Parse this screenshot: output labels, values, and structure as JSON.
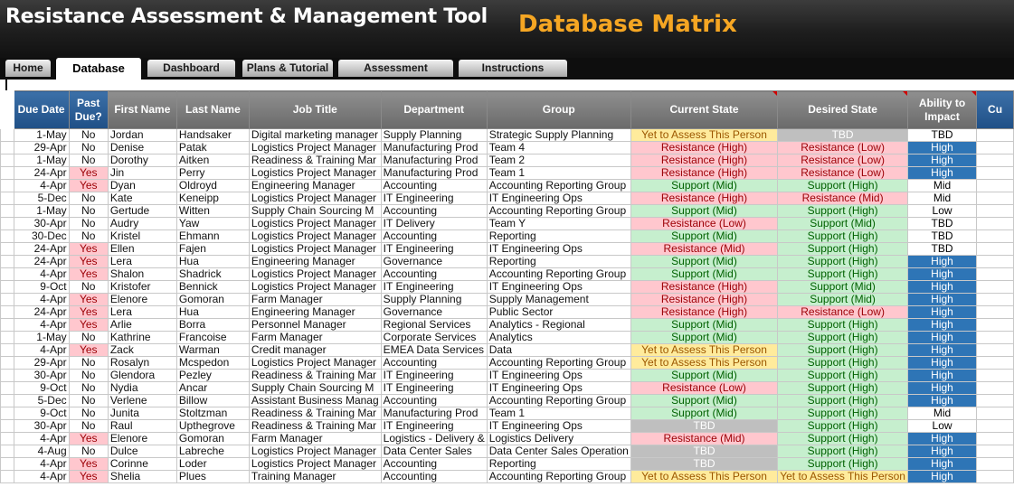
{
  "app": {
    "title": "Resistance Assessment & Management Tool",
    "subtitle": "Database Matrix"
  },
  "tabs": [
    {
      "label": "Home"
    },
    {
      "label": "Database"
    },
    {
      "label": "Dashboard"
    },
    {
      "label": "Plans & Tutorial"
    },
    {
      "label": "Assessment"
    },
    {
      "label": "Instructions"
    }
  ],
  "columns": [
    "Due Date",
    "Past Due?",
    "First Name",
    "Last Name",
    "Job Title",
    "Department",
    "Group",
    "Current State",
    "Desired State",
    "Ability to Impact",
    "Cu"
  ],
  "colors": {
    "header_blue": "#2b5f97",
    "header_gray": "#7a7a7a",
    "yes_bg": "#ffc7ce",
    "resistance_bg": "#ffc7ce",
    "support_bg": "#c6efce",
    "yet_bg": "#ffeb9c",
    "tbd_bg": "#bfbfbf",
    "high_bg": "#2e75b6"
  },
  "rows": [
    [
      "1-May",
      "No",
      "Jordan",
      "Handsaker",
      "Digital marketing manager",
      "Supply Planning",
      "Strategic Supply Planning",
      "Yet to Assess This Person",
      "TBD",
      "TBD"
    ],
    [
      "29-Apr",
      "No",
      "Denise",
      "Patak",
      "Logistics Project Manager",
      "Manufacturing Prod",
      "Team 4",
      "Resistance (High)",
      "Resistance (Low)",
      "High"
    ],
    [
      "1-May",
      "No",
      "Dorothy",
      "Aitken",
      "Readiness & Training Mar",
      "Manufacturing Prod",
      "Team 2",
      "Resistance (High)",
      "Resistance (Low)",
      "High"
    ],
    [
      "24-Apr",
      "Yes",
      "Jin",
      "Perry",
      "Logistics Project Manager",
      "Manufacturing Prod",
      "Team 1",
      "Resistance (High)",
      "Resistance (Low)",
      "High"
    ],
    [
      "4-Apr",
      "Yes",
      "Dyan",
      "Oldroyd",
      "Engineering Manager",
      "Accounting",
      "Accounting Reporting Group",
      "Support (Mid)",
      "Support (High)",
      "Mid"
    ],
    [
      "5-Dec",
      "No",
      "Kate",
      "Keneipp",
      "Logistics Project Manager",
      "IT Engineering",
      "IT Engineering Ops",
      "Resistance (High)",
      "Resistance (Mid)",
      "Mid"
    ],
    [
      "1-May",
      "No",
      "Gertude",
      "Witten",
      "Supply Chain Sourcing M",
      "Accounting",
      "Accounting Reporting Group",
      "Support (Mid)",
      "Support (High)",
      "Low"
    ],
    [
      "30-Apr",
      "No",
      "Audry",
      "Yaw",
      "Logistics Project Manager",
      "IT Delivery",
      "Team Y",
      "Resistance (Low)",
      "Support (Mid)",
      "TBD"
    ],
    [
      "30-Dec",
      "No",
      "Kristel",
      "Ehmann",
      "Logistics Project Manager",
      "Accounting",
      "Reporting",
      "Support (Mid)",
      "Support (High)",
      "TBD"
    ],
    [
      "24-Apr",
      "Yes",
      "Ellen",
      "Fajen",
      "Logistics Project Manager",
      "IT Engineering",
      "IT Engineering Ops",
      "Resistance (Mid)",
      "Support (High)",
      "TBD"
    ],
    [
      "24-Apr",
      "Yes",
      "Lera",
      "Hua",
      "Engineering Manager",
      "Governance",
      "Reporting",
      "Support (Mid)",
      "Support (High)",
      "High"
    ],
    [
      "4-Apr",
      "Yes",
      "Shalon",
      "Shadrick",
      "Logistics Project Manager",
      "Accounting",
      "Accounting Reporting Group",
      "Support (Mid)",
      "Support (High)",
      "High"
    ],
    [
      "9-Oct",
      "No",
      "Kristofer",
      "Bennick",
      "Logistics Project Manager",
      "IT Engineering",
      "IT Engineering Ops",
      "Resistance (High)",
      "Support (Mid)",
      "High"
    ],
    [
      "4-Apr",
      "Yes",
      "Elenore",
      "Gomoran",
      "Farm Manager",
      "Supply Planning",
      "Supply Management",
      "Resistance (High)",
      "Support (Mid)",
      "High"
    ],
    [
      "24-Apr",
      "Yes",
      "Lera",
      "Hua",
      "Engineering Manager",
      "Governance",
      "Public Sector",
      "Resistance (High)",
      "Resistance (Low)",
      "High"
    ],
    [
      "4-Apr",
      "Yes",
      "Arlie",
      "Borra",
      "Personnel Manager",
      "Regional Services",
      "Analytics - Regional",
      "Support (Mid)",
      "Support (High)",
      "High"
    ],
    [
      "1-May",
      "No",
      "Kathrine",
      "Francoise",
      "Farm Manager",
      "Corporate Services",
      "Analytics",
      "Support (Mid)",
      "Support (High)",
      "High"
    ],
    [
      "4-Apr",
      "Yes",
      "Zack",
      "Warman",
      "Credit manager",
      "EMEA Data Services",
      "Data",
      "Yet to Assess This Person",
      "Support (High)",
      "High"
    ],
    [
      "29-Apr",
      "No",
      "Rosalyn",
      "Mcspedon",
      "Logistics Project Manager",
      "Accounting",
      "Accounting Reporting Group",
      "Yet to Assess This Person",
      "Support (High)",
      "High"
    ],
    [
      "30-Apr",
      "No",
      "Glendora",
      "Pezley",
      "Readiness & Training Mar",
      "IT Engineering",
      "IT Engineering Ops",
      "Support (Mid)",
      "Support (High)",
      "High"
    ],
    [
      "9-Oct",
      "No",
      "Nydia",
      "Ancar",
      "Supply Chain Sourcing M",
      "IT Engineering",
      "IT Engineering Ops",
      "Resistance (Low)",
      "Support (High)",
      "High"
    ],
    [
      "5-Dec",
      "No",
      "Verlene",
      "Billow",
      "Assistant Business Manag",
      "Accounting",
      "Accounting Reporting Group",
      "Support (Mid)",
      "Support (High)",
      "High"
    ],
    [
      "9-Oct",
      "No",
      "Junita",
      "Stoltzman",
      "Readiness & Training Mar",
      "Manufacturing Prod",
      "Team 1",
      "Support (Mid)",
      "Support (High)",
      "Mid"
    ],
    [
      "30-Apr",
      "No",
      "Raul",
      "Upthegrove",
      "Readiness & Training Mar",
      "IT Engineering",
      "IT Engineering Ops",
      "TBD",
      "Support (High)",
      "Low"
    ],
    [
      "4-Apr",
      "Yes",
      "Elenore",
      "Gomoran",
      "Farm Manager",
      "Logistics - Delivery &",
      "Logistics Delivery",
      "Resistance (Mid)",
      "Support (High)",
      "High"
    ],
    [
      "4-Aug",
      "No",
      "Dulce",
      "Labreche",
      "Logistics Project Manager",
      "Data Center Sales",
      "Data Center Sales Operation",
      "TBD",
      "Support (High)",
      "High"
    ],
    [
      "4-Apr",
      "Yes",
      "Corinne",
      "Loder",
      "Logistics Project Manager",
      "Accounting",
      "Reporting",
      "TBD",
      "Support (High)",
      "High"
    ],
    [
      "4-Apr",
      "Yes",
      "Shelia",
      "Plues",
      "Training Manager",
      "Accounting",
      "Accounting Reporting Group",
      "Yet to Assess This Person",
      "Yet to Assess This Person",
      "High"
    ]
  ]
}
